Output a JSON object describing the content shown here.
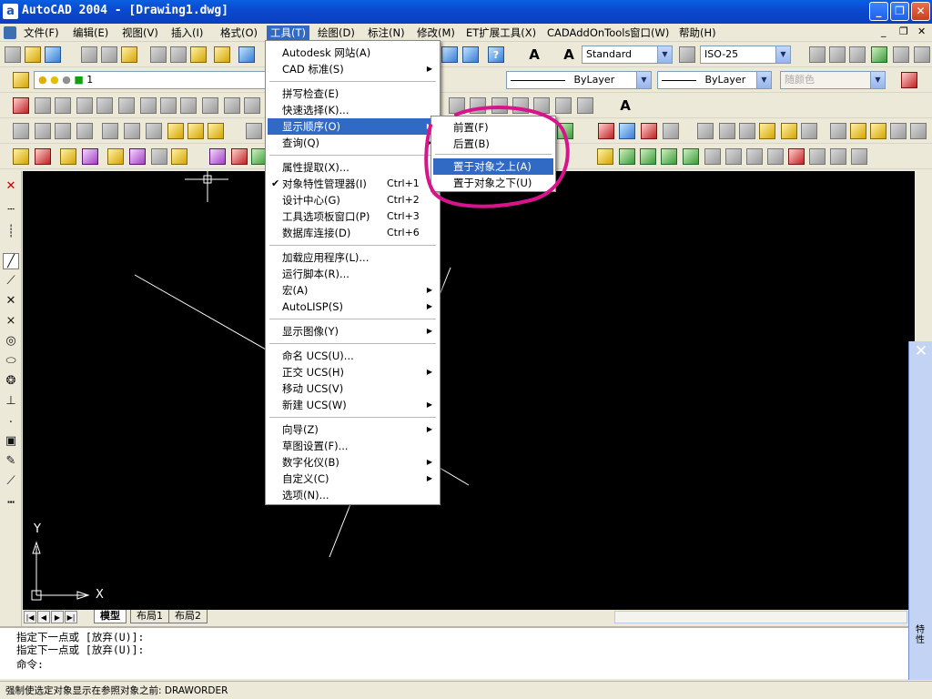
{
  "window": {
    "icon_letter": "a",
    "title": "AutoCAD 2004 - [Drawing1.dwg]",
    "min_glyph": "_",
    "max_glyph": "❐",
    "close_glyph": "✕"
  },
  "menubar": {
    "items": [
      "文件(F)",
      "编辑(E)",
      "视图(V)",
      "插入(I)",
      "格式(O)",
      "工具(T)",
      "绘图(D)",
      "标注(N)",
      "修改(M)",
      "ET扩展工具(X)",
      "CADAddOnTools",
      "窗口(W)",
      "帮助(H)"
    ],
    "doc_controls": [
      "_",
      "❐",
      "✕"
    ]
  },
  "toolbar": {
    "layer_value": "1",
    "text_style": "Standard",
    "dim_style": "ISO-25",
    "linetype": "ByLayer",
    "lineweight": "ByLayer",
    "plot_style": "随颜色",
    "text_tool_glyph": "A",
    "help_glyph": "?"
  },
  "tools_menu": {
    "groups": [
      [
        {
          "label": "Autodesk 网站(A)",
          "sub": false
        },
        {
          "label": "CAD 标准(S)",
          "sub": true
        }
      ],
      [
        {
          "label": "拼写检查(E)",
          "sub": false
        },
        {
          "label": "快速选择(K)...",
          "sub": false
        },
        {
          "label": "显示顺序(O)",
          "sub": true,
          "highlighted": true
        },
        {
          "label": "查询(Q)",
          "sub": true
        }
      ],
      [
        {
          "label": "属性提取(X)...",
          "sub": false
        },
        {
          "label": "对象特性管理器(I)",
          "shortcut": "Ctrl+1",
          "checked": true
        },
        {
          "label": "设计中心(G)",
          "shortcut": "Ctrl+2"
        },
        {
          "label": "工具选项板窗口(P)",
          "shortcut": "Ctrl+3"
        },
        {
          "label": "数据库连接(D)",
          "shortcut": "Ctrl+6"
        }
      ],
      [
        {
          "label": "加载应用程序(L)...",
          "sub": false
        },
        {
          "label": "运行脚本(R)...",
          "sub": false
        },
        {
          "label": "宏(A)",
          "sub": true
        },
        {
          "label": "AutoLISP(S)",
          "sub": true
        }
      ],
      [
        {
          "label": "显示图像(Y)",
          "sub": true
        }
      ],
      [
        {
          "label": "命名 UCS(U)...",
          "sub": false
        },
        {
          "label": "正交 UCS(H)",
          "sub": true
        },
        {
          "label": "移动 UCS(V)",
          "sub": false
        },
        {
          "label": "新建 UCS(W)",
          "sub": true
        }
      ],
      [
        {
          "label": "向导(Z)",
          "sub": true
        },
        {
          "label": "草图设置(F)...",
          "sub": false
        },
        {
          "label": "数字化仪(B)",
          "sub": true
        },
        {
          "label": "自定义(C)",
          "sub": true
        },
        {
          "label": "选项(N)...",
          "sub": false
        }
      ]
    ],
    "check_glyph": "✔",
    "sub_glyph": "▶"
  },
  "draw_order_submenu": {
    "items": [
      {
        "label": "前置(F)"
      },
      {
        "label": "后置(B)"
      },
      {
        "label": "置于对象之上(A)",
        "highlighted": true
      },
      {
        "label": "置于对象之下(U)"
      }
    ],
    "annotation_color": "#d8148c"
  },
  "layout_tabs": {
    "tabs": [
      "模型",
      "布局1",
      "布局2"
    ],
    "active": 0
  },
  "ucs": {
    "x_label": "X",
    "y_label": "Y"
  },
  "command_lines": [
    "指定下一点或 [放弃(U)]:",
    "指定下一点或 [放弃(U)]:",
    "命令:"
  ],
  "status_text": "强制使选定对象显示在参照对象之前: DRAWORDER",
  "palette": {
    "close_glyph": "✕",
    "label": "特性"
  },
  "colors": {
    "title_blue": "#0b4ad0",
    "highlight": "#316ac5",
    "canvas": "#000000"
  }
}
